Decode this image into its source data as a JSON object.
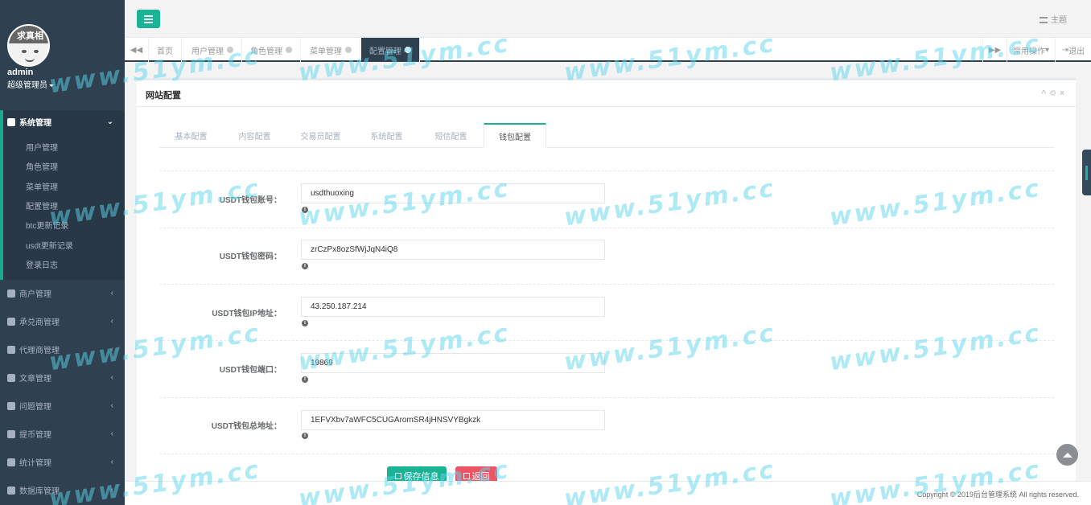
{
  "sidebar": {
    "avatar_caption": "求真相",
    "username": "admin",
    "role": "超级管理员",
    "active_group": {
      "label": "系统管理",
      "items": [
        {
          "label": "用户管理"
        },
        {
          "label": "角色管理"
        },
        {
          "label": "菜单管理"
        },
        {
          "label": "配置管理"
        },
        {
          "label": "btc更新记录"
        },
        {
          "label": "usdt更新记录"
        },
        {
          "label": "登录日志"
        }
      ]
    },
    "groups": [
      {
        "label": "商户管理"
      },
      {
        "label": "承兑商管理"
      },
      {
        "label": "代理商管理"
      },
      {
        "label": "文章管理"
      },
      {
        "label": "问题管理"
      },
      {
        "label": "提币管理"
      },
      {
        "label": "统计管理"
      },
      {
        "label": "数据库管理"
      }
    ]
  },
  "topbar": {
    "theme_label": "主题"
  },
  "page_tabs": [
    {
      "label": "首页"
    },
    {
      "label": "用户管理"
    },
    {
      "label": "角色管理"
    },
    {
      "label": "菜单管理"
    },
    {
      "label": "配置管理"
    }
  ],
  "tab_actions": {
    "common_ops": "常用操作",
    "logout": "退出"
  },
  "panel": {
    "title": "网站配置",
    "config_tabs": [
      {
        "label": "基本配置"
      },
      {
        "label": "内容配置"
      },
      {
        "label": "交易员配置"
      },
      {
        "label": "系统配置"
      },
      {
        "label": "短信配置"
      },
      {
        "label": "钱包配置"
      }
    ],
    "fields": [
      {
        "label": "USDT钱包账号：",
        "value": "usdthuoxing"
      },
      {
        "label": "USDT钱包密码：",
        "value": "zrCzPx8ozSfWjJqN4iQ8"
      },
      {
        "label": "USDT钱包IP地址：",
        "value": "43.250.187.214"
      },
      {
        "label": "USDT钱包端口：",
        "value": "19869"
      },
      {
        "label": "USDT钱包总地址：",
        "value": "1EFVXbv7aWFC5CUGAromSR4jHNSVYBgkzk"
      }
    ],
    "save_label": "保存信息",
    "back_label": "返回"
  },
  "footer": {
    "copyright": "Copyright © 2019后台管理系统 All rights reserved."
  },
  "watermark": "www.51ym.cc"
}
